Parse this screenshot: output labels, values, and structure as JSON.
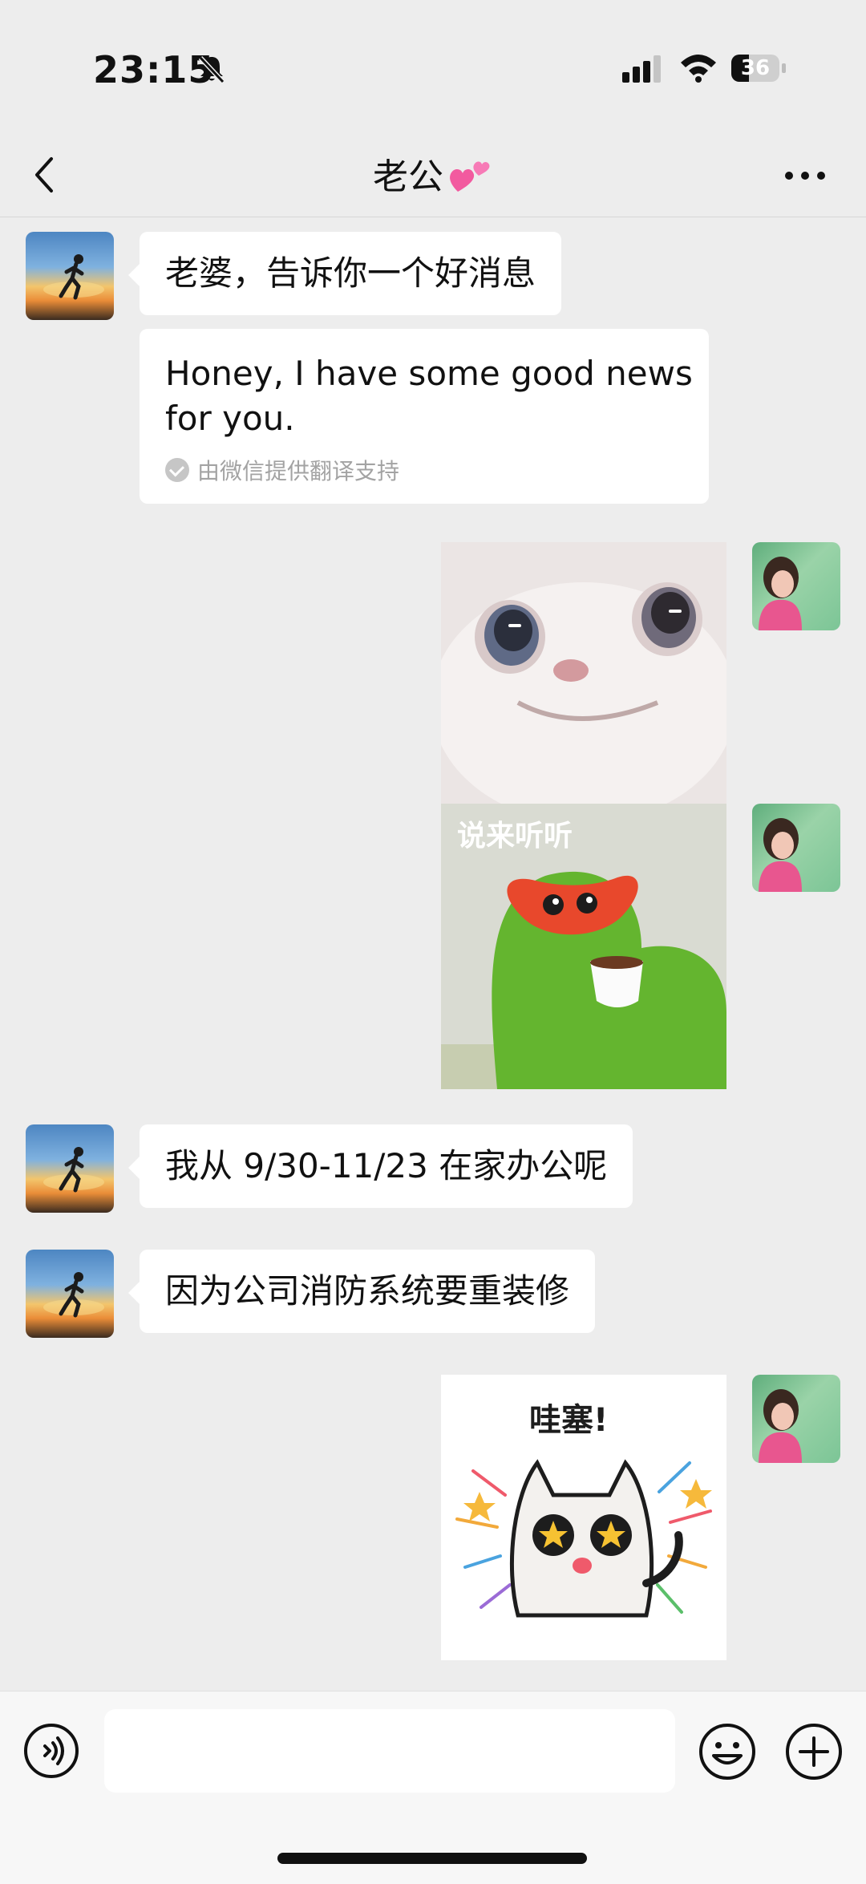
{
  "status_bar": {
    "time": "23:15",
    "battery": "36",
    "battery_level": 0.36
  },
  "nav": {
    "title": "老公",
    "back_icon": "chevron-left-icon",
    "more_icon": "more-dots-icon"
  },
  "messages": {
    "m1": "老婆，告诉你一个好消息",
    "translation": "Honey, I have some good news for you.",
    "translation_note": "由微信提供翻译支持",
    "sticker2_caption": "说来听听",
    "m2": "我从 9/30-11/23 在家办公呢",
    "m3": "因为公司消防系统要重装修",
    "sticker3_caption": "哇塞!"
  },
  "input_bar": {
    "placeholder": ""
  },
  "colors": {
    "background": "#ededed",
    "bubble": "#ffffff",
    "input_bg": "#f7f7f7"
  }
}
